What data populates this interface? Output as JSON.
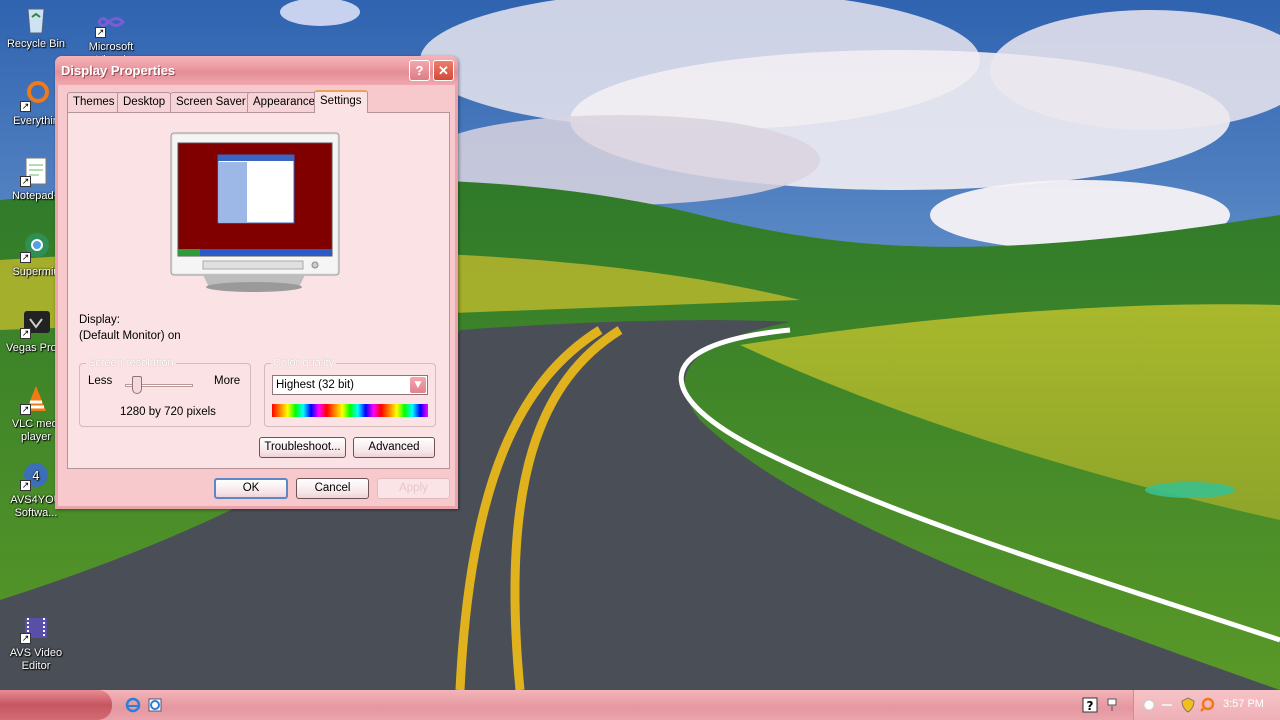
{
  "desktop": {
    "icons": [
      {
        "label": "Recycle Bin",
        "icon": "recycle-bin-icon"
      },
      {
        "label": "Microsoft Visual",
        "icon": "visual-studio-icon"
      },
      {
        "label": "Everythin",
        "icon": "everything-search-icon"
      },
      {
        "label": "Notepad+",
        "icon": "notepad-plus-icon"
      },
      {
        "label": "Supermiu",
        "icon": "supermium-browser-icon"
      },
      {
        "label": "Vegas Pro 1",
        "icon": "vegas-pro-icon"
      },
      {
        "label": "VLC medi player",
        "icon": "vlc-icon"
      },
      {
        "label": "AVS4YOU Softwa...",
        "icon": "avs4you-icon"
      },
      {
        "label": "AVS Video Editor",
        "icon": "avs-video-editor-icon"
      }
    ]
  },
  "dialog": {
    "title": "Display Properties",
    "help_label": "?",
    "close_label": "✕",
    "tabs": [
      "Themes",
      "Desktop",
      "Screen Saver",
      "Appearance",
      "Settings"
    ],
    "active_tab": "Settings",
    "display_label": "Display:",
    "display_value": "(Default Monitor) on",
    "resolution": {
      "legend": "Screen resolution",
      "less_label": "Less",
      "more_label": "More",
      "value_text": "1280 by 720 pixels",
      "slider_level": 0.18
    },
    "color_quality": {
      "legend": "Color quality",
      "selected": "Highest (32 bit)"
    },
    "buttons": {
      "troubleshoot": "Troubleshoot...",
      "advanced": "Advanced",
      "ok": "OK",
      "cancel": "Cancel",
      "apply": "Apply"
    }
  },
  "taskbar": {
    "quick_launch": [
      "internet-explorer-icon",
      "ie-shortcut-icon"
    ],
    "tray_icons": [
      "help-icon",
      "network-icon",
      "speaker-icon",
      "shield-icon",
      "search-icon"
    ],
    "clock": "3:57 PM"
  },
  "colors": {
    "window_pink": "#f7c9cd",
    "titlebar": "#e38d96",
    "taskbar": "#e9a0a7",
    "monitor_bg": "#800000"
  }
}
